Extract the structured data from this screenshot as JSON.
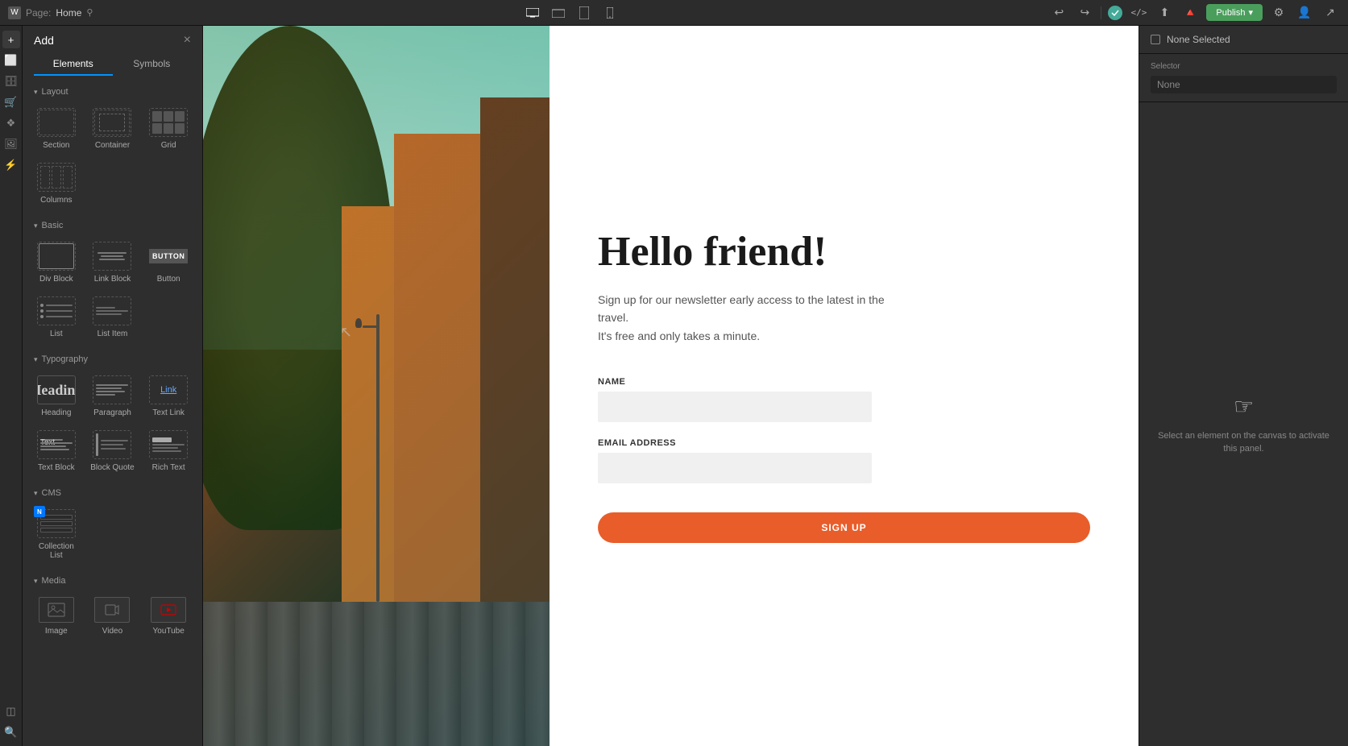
{
  "topbar": {
    "page_label": "Page:",
    "page_name": "Home",
    "publish_label": "Publish",
    "undo_icon": "↩",
    "redo_icon": "↪",
    "devices": [
      {
        "name": "desktop",
        "icon": "⬜",
        "active": true
      },
      {
        "name": "tablet-landscape",
        "icon": "▭"
      },
      {
        "name": "tablet-portrait",
        "icon": "▯"
      },
      {
        "name": "mobile",
        "icon": "📱"
      }
    ]
  },
  "add_panel": {
    "title": "Add",
    "close": "×",
    "tabs": [
      {
        "id": "elements",
        "label": "Elements",
        "active": true
      },
      {
        "id": "symbols",
        "label": "Symbols"
      }
    ],
    "sections": {
      "layout": {
        "label": "Layout",
        "items": [
          {
            "id": "section",
            "label": "Section"
          },
          {
            "id": "container",
            "label": "Container"
          },
          {
            "id": "grid",
            "label": "Grid"
          },
          {
            "id": "columns",
            "label": "Columns"
          }
        ]
      },
      "basic": {
        "label": "Basic",
        "items": [
          {
            "id": "div-block",
            "label": "Div Block"
          },
          {
            "id": "link-block",
            "label": "Link Block"
          },
          {
            "id": "button",
            "label": "Button"
          },
          {
            "id": "list",
            "label": "List"
          },
          {
            "id": "list-item",
            "label": "List Item"
          }
        ]
      },
      "typography": {
        "label": "Typography",
        "items": [
          {
            "id": "heading",
            "label": "Heading"
          },
          {
            "id": "paragraph",
            "label": "Paragraph"
          },
          {
            "id": "text-link",
            "label": "Text Link"
          },
          {
            "id": "text-block",
            "label": "Text Block"
          },
          {
            "id": "block-quote",
            "label": "Block Quote"
          },
          {
            "id": "rich-text",
            "label": "Rich Text"
          }
        ]
      },
      "cms": {
        "label": "CMS",
        "items": [
          {
            "id": "collection-list",
            "label": "Collection List"
          }
        ]
      },
      "media": {
        "label": "Media",
        "items": [
          {
            "id": "image",
            "label": "Image"
          },
          {
            "id": "video",
            "label": "Video"
          },
          {
            "id": "youtube",
            "label": "YouTube"
          }
        ]
      }
    }
  },
  "canvas": {
    "hero_title": "Hello friend!",
    "hero_subtitle_line1": "Sign up for our newsletter early access to the latest in the travel.",
    "hero_subtitle_line2": "It's free and only takes a minute.",
    "form": {
      "name_label": "NAME",
      "email_label": "EMAIL ADDRESS",
      "submit_label": "SIGN UP"
    }
  },
  "right_panel": {
    "none_selected_label": "None Selected",
    "selector_label": "Selector",
    "selector_value": "None",
    "empty_state_text": "Select an element on the canvas to activate this panel."
  }
}
